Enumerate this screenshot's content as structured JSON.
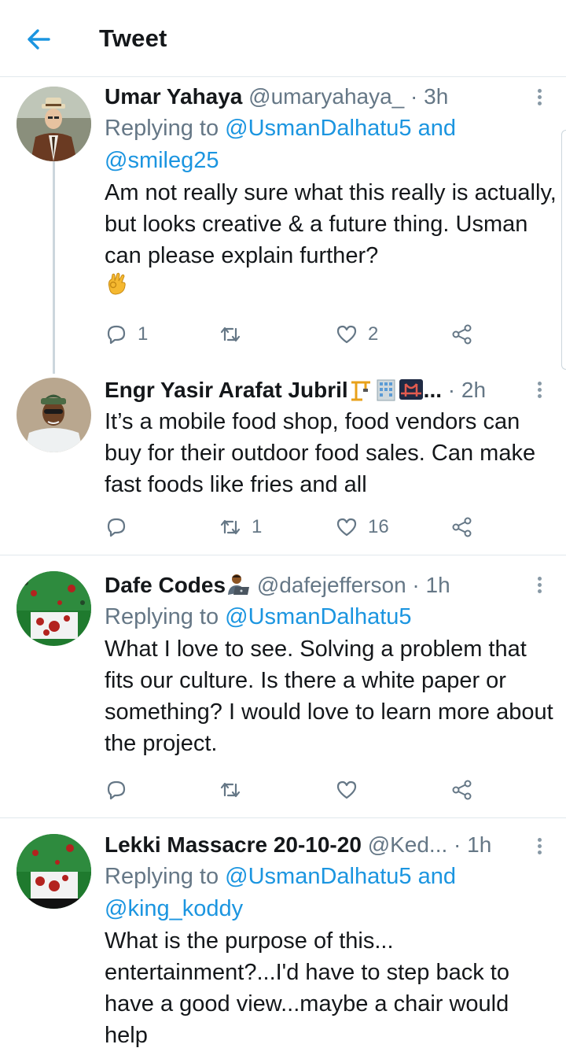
{
  "header": {
    "title": "Tweet",
    "back_icon": "arrow-left-icon",
    "accent": "#1b95e0"
  },
  "tweets": [
    {
      "name": "Umar Yahaya",
      "handle": "@umaryahaya_",
      "time": "3h",
      "replying_prefix": "Replying to ",
      "replying_to_1": "@UsmanDalhatu5",
      "replying_joiner": " and",
      "replying_to_2": "@smileg25",
      "text": "Am not really sure what this really is actually, but looks creative & a future thing. Usman can please explain further?",
      "emoji": "ok-hand-emoji",
      "replies": "1",
      "retweets": "",
      "likes": "2"
    },
    {
      "name": "Engr Yasir Arafat Jubril",
      "name_emoji": [
        "construction-crane-emoji",
        "office-building-emoji",
        "bridge-at-night-emoji"
      ],
      "name_ellipsis": "...",
      "time": "2h",
      "text": "It’s a mobile food shop, food vendors can buy for their outdoor food sales. Can make fast foods like fries and all",
      "replies": "",
      "retweets": "1",
      "likes": "16"
    },
    {
      "name": "Dafe Codes",
      "name_emoji": [
        "technologist-emoji"
      ],
      "handle": "@dafejefferson",
      "time": "1h",
      "replying_prefix": "Replying to ",
      "replying_to_1": "@UsmanDalhatu5",
      "text": "What I love to see. Solving a problem that fits our culture. Is there a white paper or something? I would love to learn more about the project.",
      "replies": "",
      "retweets": "",
      "likes": ""
    },
    {
      "name": "Lekki Massacre 20-10-20",
      "handle": "@Ked...",
      "time": "1h",
      "replying_prefix": "Replying to ",
      "replying_to_1": "@UsmanDalhatu5",
      "replying_joiner": " and",
      "replying_to_2": "@king_koddy",
      "text": "What is the purpose of this... entertainment?...I'd have to step back to have a good view...maybe a chair would help"
    }
  ],
  "dot_separator": " · ",
  "icons": {
    "reply": "reply-icon",
    "retweet": "retweet-icon",
    "like": "heart-icon",
    "share": "share-icon",
    "more": "more-vertical-icon"
  }
}
